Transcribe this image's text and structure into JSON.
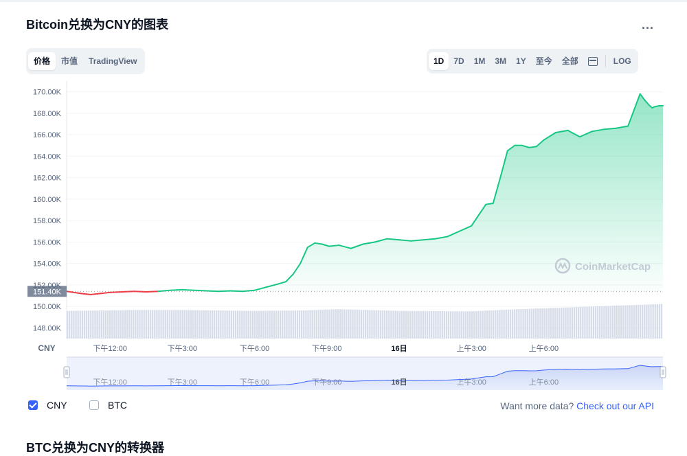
{
  "header": {
    "title": "Bitcoin兑换为CNY的图表",
    "more_label": "..."
  },
  "view_tabs": [
    {
      "label": "价格",
      "active": true
    },
    {
      "label": "市值",
      "active": false
    },
    {
      "label": "TradingView",
      "active": false
    }
  ],
  "range_tabs": [
    {
      "label": "1D",
      "active": true
    },
    {
      "label": "7D",
      "active": false
    },
    {
      "label": "1M",
      "active": false
    },
    {
      "label": "3M",
      "active": false
    },
    {
      "label": "1Y",
      "active": false
    },
    {
      "label": "至今",
      "active": false
    },
    {
      "label": "全部",
      "active": false
    }
  ],
  "calendar_icon": "calendar-icon",
  "log_label": "LOG",
  "watermark": "CoinMarketCap",
  "colors": {
    "up": "#16c784",
    "down": "#ea3943",
    "accent": "#3861fb",
    "volume": "#cfd6e4",
    "price_tag": "#808a9d"
  },
  "chart_data": {
    "type": "line",
    "currency_label": "CNY",
    "open_price": 151.4,
    "open_price_label": "151.40K",
    "ylim": [
      147,
      171
    ],
    "yticks": [
      148,
      150,
      152,
      154,
      156,
      158,
      160,
      162,
      164,
      166,
      168,
      170
    ],
    "ytick_labels": [
      "148.00K",
      "150.00K",
      "152.00K",
      "154.00K",
      "156.00K",
      "158.00K",
      "160.00K",
      "162.00K",
      "164.00K",
      "166.00K",
      "168.00K",
      "170.00K"
    ],
    "x_range": [
      10.2,
      34.95
    ],
    "xticks": [
      12,
      15,
      18,
      21,
      24,
      27,
      30
    ],
    "xtick_labels": [
      "下午12:00",
      "下午3:00",
      "下午6:00",
      "下午9:00",
      "16日",
      "上午3:00",
      "上午6:00"
    ],
    "xtick_bold": [
      false,
      false,
      false,
      false,
      true,
      false,
      false
    ],
    "series": [
      {
        "unit": "K CNY",
        "x": [
          10.2,
          10.5,
          10.8,
          11.2,
          11.6,
          12.0,
          12.5,
          13.0,
          13.5,
          14.0,
          14.5,
          15.0,
          15.5,
          16.0,
          16.5,
          17.0,
          17.5,
          18.0,
          18.5,
          19.0,
          19.3,
          19.6,
          19.9,
          20.2,
          20.5,
          20.8,
          21.1,
          21.5,
          22.0,
          22.5,
          23.0,
          23.5,
          24.0,
          24.5,
          25.0,
          25.5,
          26.0,
          26.5,
          27.0,
          27.3,
          27.6,
          27.9,
          28.2,
          28.5,
          28.8,
          29.1,
          29.4,
          29.7,
          30.0,
          30.5,
          31.0,
          31.5,
          32.0,
          32.5,
          33.0,
          33.5,
          34.0,
          34.2,
          34.4,
          34.5,
          34.6,
          34.8,
          34.95
        ],
        "values": [
          151.4,
          151.3,
          151.2,
          151.1,
          151.2,
          151.3,
          151.35,
          151.4,
          151.35,
          151.4,
          151.5,
          151.55,
          151.5,
          151.45,
          151.4,
          151.45,
          151.4,
          151.5,
          151.8,
          152.1,
          152.3,
          153.0,
          154.0,
          155.5,
          155.9,
          155.8,
          155.6,
          155.7,
          155.4,
          155.8,
          156.0,
          156.3,
          156.2,
          156.1,
          156.2,
          156.3,
          156.5,
          157.0,
          157.5,
          158.5,
          159.5,
          159.6,
          162.0,
          164.5,
          165.0,
          165.0,
          164.8,
          164.9,
          165.5,
          166.2,
          166.4,
          165.8,
          166.3,
          166.5,
          166.6,
          166.8,
          169.8,
          169.2,
          168.7,
          168.5,
          168.6,
          168.7,
          168.7
        ]
      }
    ],
    "volume": {
      "x": [
        10.2,
        13.0,
        15.0,
        18.0,
        20.0,
        21.5,
        24.0,
        27.0,
        29.0,
        31.0,
        33.0,
        34.95
      ],
      "relative": [
        0.64,
        0.66,
        0.66,
        0.64,
        0.65,
        0.68,
        0.64,
        0.63,
        0.68,
        0.72,
        0.76,
        0.8
      ]
    },
    "grid": true
  },
  "navigator": {
    "xtick_labels": [
      "下午12:00",
      "下午3:00",
      "下午6:00",
      "下午9:00",
      "16日",
      "上午3:00",
      "上午6:00"
    ]
  },
  "legend": [
    {
      "label": "CNY",
      "checked": true
    },
    {
      "label": "BTC",
      "checked": false
    }
  ],
  "footer": {
    "more_data_text": "Want more data?",
    "api_link": "Check out our API",
    "next_section_title": "BTC兑换为CNY的转换器"
  }
}
